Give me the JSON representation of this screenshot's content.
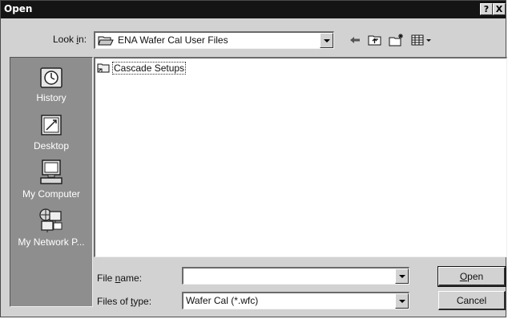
{
  "window": {
    "title": "Open",
    "help_label": "?",
    "close_label": "X"
  },
  "look_in": {
    "label_prefix": "Look ",
    "label_mnemonic": "i",
    "label_suffix": "n:",
    "value": "ENA Wafer Cal User Files",
    "icon": "open-folder-icon"
  },
  "toolbar": {
    "items": [
      "back-arrow-icon",
      "up-one-level-icon",
      "new-folder-icon",
      "view-menu-icon"
    ]
  },
  "places": {
    "items": [
      {
        "label": "History",
        "icon": "history-icon"
      },
      {
        "label": "Desktop",
        "icon": "desktop-icon"
      },
      {
        "label": "My Computer",
        "icon": "my-computer-icon"
      },
      {
        "label": "My Network P...",
        "icon": "network-places-icon"
      }
    ]
  },
  "files": {
    "items": [
      {
        "name": "Cascade Setups",
        "icon": "folder-icon"
      }
    ]
  },
  "file_name": {
    "label_prefix": "File ",
    "label_mnemonic": "n",
    "label_suffix": "ame:",
    "value": ""
  },
  "file_type": {
    "label_prefix": "Files of ",
    "label_mnemonic": "t",
    "label_suffix": "ype:",
    "value": "Wafer Cal (*.wfc)"
  },
  "buttons": {
    "open_mnemonic": "O",
    "open_rest": "pen",
    "cancel": "Cancel"
  }
}
